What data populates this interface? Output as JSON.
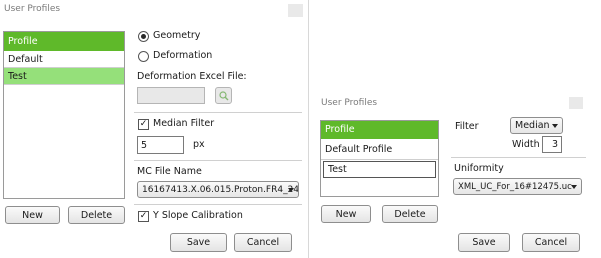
{
  "left_dialog": {
    "title": "User Profiles",
    "profiles": {
      "header": "Profile",
      "items": [
        "Default",
        "Test"
      ]
    },
    "mode": {
      "geometry_label": "Geometry",
      "deformation_label": "Deformation",
      "selected": "Geometry"
    },
    "deformation_excel": {
      "label": "Deformation Excel File:",
      "value": ""
    },
    "median_filter": {
      "label": "Median Filter",
      "checked": true,
      "value": "5",
      "unit": "px"
    },
    "mc_file": {
      "label": "MC File Name",
      "selected": "16167413.X.06.015.Proton.FR4_24"
    },
    "y_slope": {
      "label": "Y Slope Calibration",
      "checked": true
    },
    "buttons": {
      "new": "New",
      "delete": "Delete",
      "save": "Save",
      "cancel": "Cancel"
    }
  },
  "right_dialog": {
    "title": "User Profiles",
    "profiles": {
      "header": "Profile",
      "items": [
        "Default Profile",
        "Test"
      ]
    },
    "filter": {
      "label": "Filter",
      "selected": "Median",
      "width_label": "Width",
      "width_value": "3"
    },
    "uniformity": {
      "label": "Uniformity",
      "selected": "XML_UC_For_16#12475.uc"
    },
    "buttons": {
      "new": "New",
      "delete": "Delete",
      "save": "Save",
      "cancel": "Cancel"
    }
  },
  "glyphs": {
    "check": "✓",
    "browse_icon": "folder-search-icon"
  }
}
